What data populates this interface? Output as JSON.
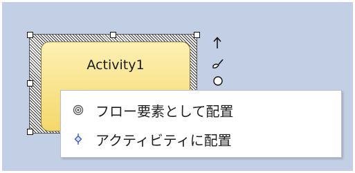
{
  "diagram": {
    "element": {
      "name": "Activity1",
      "fill_top": "#fdf0b4",
      "fill_bottom": "#f5d86a"
    },
    "quick_tools": [
      {
        "icon": "arrow-up-icon"
      },
      {
        "icon": "paint-brush-icon"
      },
      {
        "icon": "circle-icon"
      }
    ]
  },
  "context_menu": {
    "items": [
      {
        "label": "フロー要素として配置",
        "icon": "target-icon",
        "icon_color": "#5b5b5b"
      },
      {
        "label": "アクティビティに配置",
        "icon": "diamond-pin-icon",
        "icon_color": "#3b5bb5"
      }
    ]
  },
  "colors": {
    "canvas": "#c3cfe4",
    "menu_background": "#ffffff"
  }
}
